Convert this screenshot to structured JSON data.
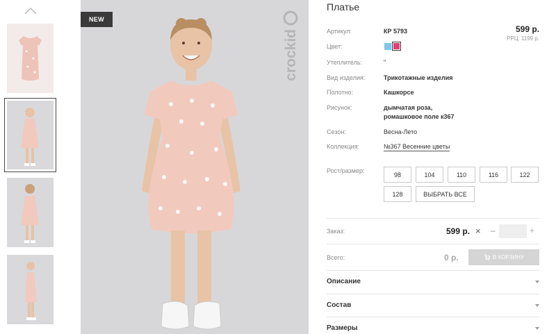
{
  "product": {
    "title": "Платье",
    "price": "599 р.",
    "rrp_label": "РРЦ:",
    "rrp_value": "1199 р.",
    "badge": "NEW"
  },
  "attributes": {
    "article": {
      "label": "Артикул:",
      "value": "КР 5793"
    },
    "color": {
      "label": "Цвет:",
      "swatches": [
        "#7fc6e9",
        "#e0407a"
      ]
    },
    "insulation": {
      "label": "Утеплитель:",
      "value": "\""
    },
    "type": {
      "label": "Вид изделия:",
      "value": "Трикотажные изделия"
    },
    "fabric": {
      "label": "Полотно:",
      "value": "Кашкорсе"
    },
    "pattern": {
      "label": "Рисунок:",
      "value_line1": "дымчатая роза,",
      "value_line2": "ромашковое поле к367"
    },
    "season": {
      "label": "Сезон:",
      "value": "Весна-Лето"
    },
    "collection": {
      "label": "Коллекция:",
      "value": "№367 Весенние цветы"
    },
    "sizes": {
      "label": "Рост/размер:",
      "options": [
        "98",
        "104",
        "110",
        "116",
        "122",
        "128"
      ],
      "select_all": "ВЫБРАТЬ ВСЕ"
    }
  },
  "order": {
    "label": "Заказ:",
    "price": "599 р.",
    "multiply": "×",
    "minus": "–",
    "plus": "+",
    "quantity": ""
  },
  "total": {
    "label": "Всего:",
    "price": "0 р.",
    "cart_button": "В КОРЗИНУ"
  },
  "accordion": [
    "Описание",
    "Состав",
    "Размеры"
  ],
  "brand": "crockid",
  "colors": {
    "photo_bg": "#d7d7d9",
    "dress": "#f2c9bd",
    "accent_dark": "#3a3a3a"
  }
}
